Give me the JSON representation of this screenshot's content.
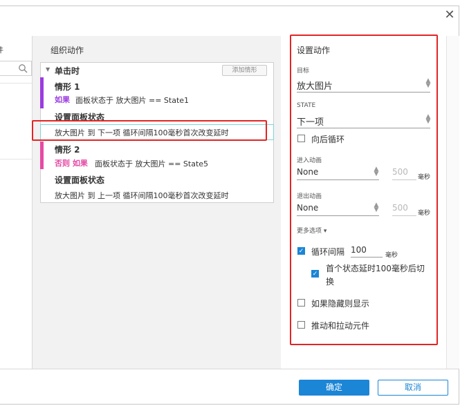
{
  "left": {
    "partial_label": "件"
  },
  "organize": {
    "title": "组织动作",
    "event": "单击时",
    "add_case": "添加情形",
    "case1": {
      "title": "情形 1",
      "keyword": "如果",
      "condition": "面板状态于 放大图片 == State1",
      "action_title": "设置面板状态",
      "action_detail": "放大图片 到 下一项 循环间隔100毫秒首次改变延时"
    },
    "case2": {
      "title": "情形 2",
      "keyword": "否则 如果",
      "condition": "面板状态于 放大图片 == State5",
      "action_title": "设置面板状态",
      "action_detail": "放大图片 到 上一项 循环间隔100毫秒首次改变延时"
    }
  },
  "settings": {
    "title": "设置动作",
    "target_label": "目标",
    "target_value": "放大图片",
    "state_label": "STATE",
    "state_value": "下一项",
    "wrap_label": "向后循环",
    "enter_anim_label": "进入动画",
    "enter_anim_value": "None",
    "enter_ms": "500",
    "ms_unit": "毫秒",
    "exit_anim_label": "退出动画",
    "exit_anim_value": "None",
    "exit_ms": "500",
    "more_options": "更多选项 ▾",
    "repeat_label": "循环间隔",
    "repeat_value": "100",
    "delay_label": "首个状态延时100毫秒后切换",
    "show_if_hidden": "如果隐藏则显示",
    "push_widgets": "推动和拉动元件"
  },
  "footer": {
    "ok": "确定",
    "cancel": "取消"
  },
  "colors": {
    "accent": "#1b85d6",
    "case1": "#9b3be0",
    "case2": "#e54aa4",
    "highlight": "#e22424"
  }
}
